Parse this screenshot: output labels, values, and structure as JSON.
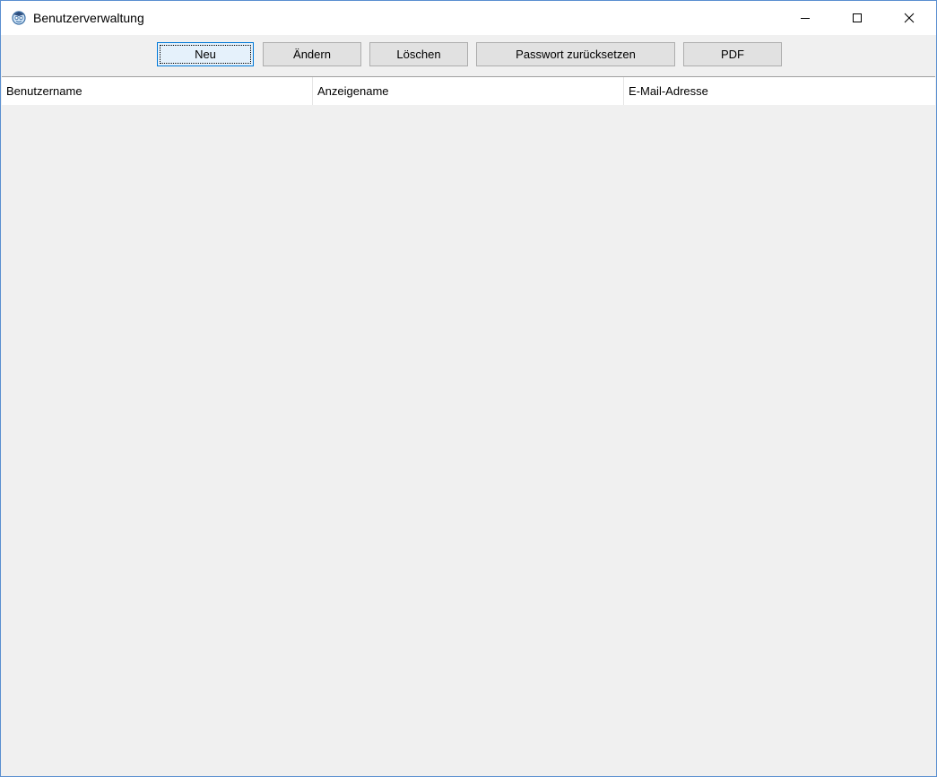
{
  "window": {
    "title": "Benutzerverwaltung",
    "icon": "app-icon",
    "controls": [
      "minimize-icon",
      "maximize-icon",
      "close-icon"
    ]
  },
  "toolbar": {
    "buttons": [
      {
        "label": "Neu",
        "default": true
      },
      {
        "label": "Ändern"
      },
      {
        "label": "Löschen"
      },
      {
        "label": "Passwort zurücksetzen"
      },
      {
        "label": "PDF"
      }
    ]
  },
  "table": {
    "columns": [
      "Benutzername",
      "Anzeigename",
      "E-Mail-Adresse"
    ],
    "rows": []
  },
  "colors": {
    "window_border": "#5a8fd0",
    "background": "#f0f0f0",
    "button_face": "#e1e1e1",
    "default_button": "#e5f1fb",
    "default_border": "#0078d7"
  }
}
